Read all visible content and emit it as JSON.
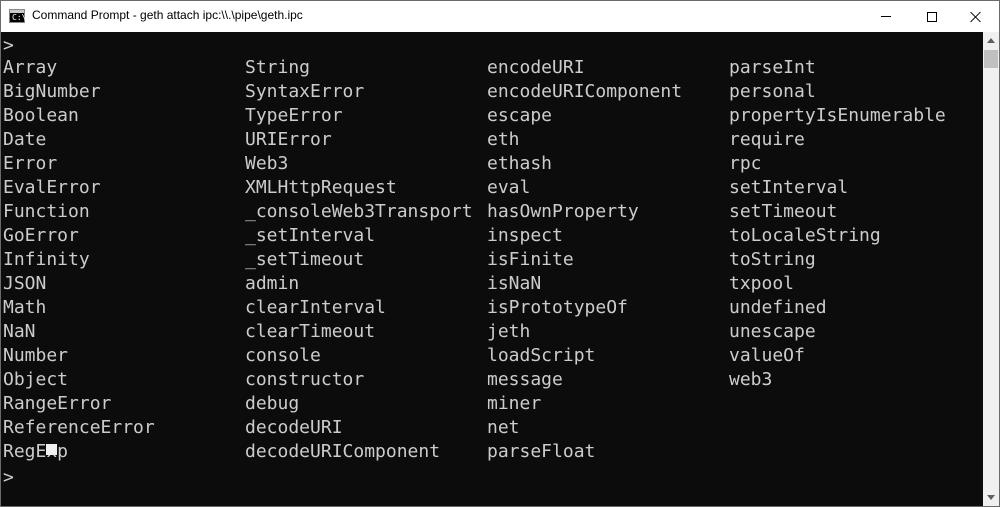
{
  "window": {
    "title": "Command Prompt - geth  attach ipc:\\\\.\\pipe\\geth.ipc",
    "icon_text": "C:\\"
  },
  "console": {
    "prompt": ">",
    "columns": [
      [
        "Array",
        "BigNumber",
        "Boolean",
        "Date",
        "Error",
        "EvalError",
        "Function",
        "GoError",
        "Infinity",
        "JSON",
        "Math",
        "NaN",
        "Number",
        "Object",
        "RangeError",
        "ReferenceError",
        "RegExp"
      ],
      [
        "String",
        "SyntaxError",
        "TypeError",
        "URIError",
        "Web3",
        "XMLHttpRequest",
        "_consoleWeb3Transport",
        "_setInterval",
        "_setTimeout",
        "admin",
        "clearInterval",
        "clearTimeout",
        "console",
        "constructor",
        "debug",
        "decodeURI",
        "decodeURIComponent"
      ],
      [
        "encodeURI",
        "encodeURIComponent",
        "escape",
        "eth",
        "ethash",
        "eval",
        "hasOwnProperty",
        "inspect",
        "isFinite",
        "isNaN",
        "isPrototypeOf",
        "jeth",
        "loadScript",
        "message",
        "miner",
        "net",
        "parseFloat"
      ],
      [
        "parseInt",
        "personal",
        "propertyIsEnumerable",
        "require",
        "rpc",
        "setInterval",
        "setTimeout",
        "toLocaleString",
        "toString",
        "txpool",
        "undefined",
        "unescape",
        "valueOf",
        "web3"
      ]
    ]
  },
  "colors": {
    "background": "#0c0c0c",
    "text": "#cccccc",
    "titlebar": "#ffffff"
  }
}
